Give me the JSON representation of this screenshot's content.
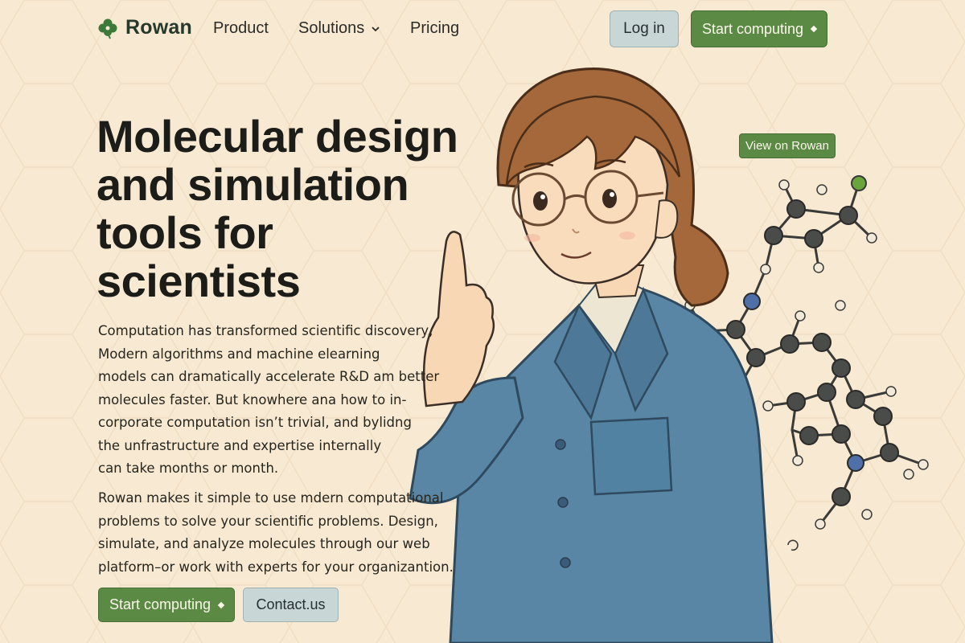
{
  "brand": {
    "name": "Rowan",
    "logo_icon": "clover-logo-icon"
  },
  "nav": {
    "product": "Product",
    "solutions": "Solutions",
    "pricing": "Pricing",
    "login": "Log in",
    "start": "Start computing"
  },
  "hero": {
    "title": "Molecular design and simulation tools for scientists",
    "para1_lines": [
      "Computation has transformed scientific discovery,",
      "Modern algorithms and machine elearning",
      "models can dramatically accelerate R&D am better",
      "molecules faster. But knowhere ana  how to in-",
      "corporate computation isn’t trivial, and bylidng",
      "the unfrastructure and expertise internally",
      "can take months or month."
    ],
    "para2_lines": [
      "Rowan makes it simple to use mdern computational",
      "problems to solve your scientific problems. Design,",
      "simulate, and analyze molecules through our web",
      "platform–or work with experts for your organizantion."
    ],
    "cta_primary": "Start computing",
    "cta_secondary": "Contact.us",
    "view_button": "View on Rowan"
  },
  "colors": {
    "background": "#f8e9d2",
    "accent_green": "#5a8a44",
    "button_gray": "#c8d6d6",
    "coat_blue": "#5a86a6",
    "hair_brown": "#a5683a"
  },
  "icons": [
    "clover-logo-icon",
    "chevron-down-icon",
    "diamond-icon",
    "molecule-icon"
  ]
}
